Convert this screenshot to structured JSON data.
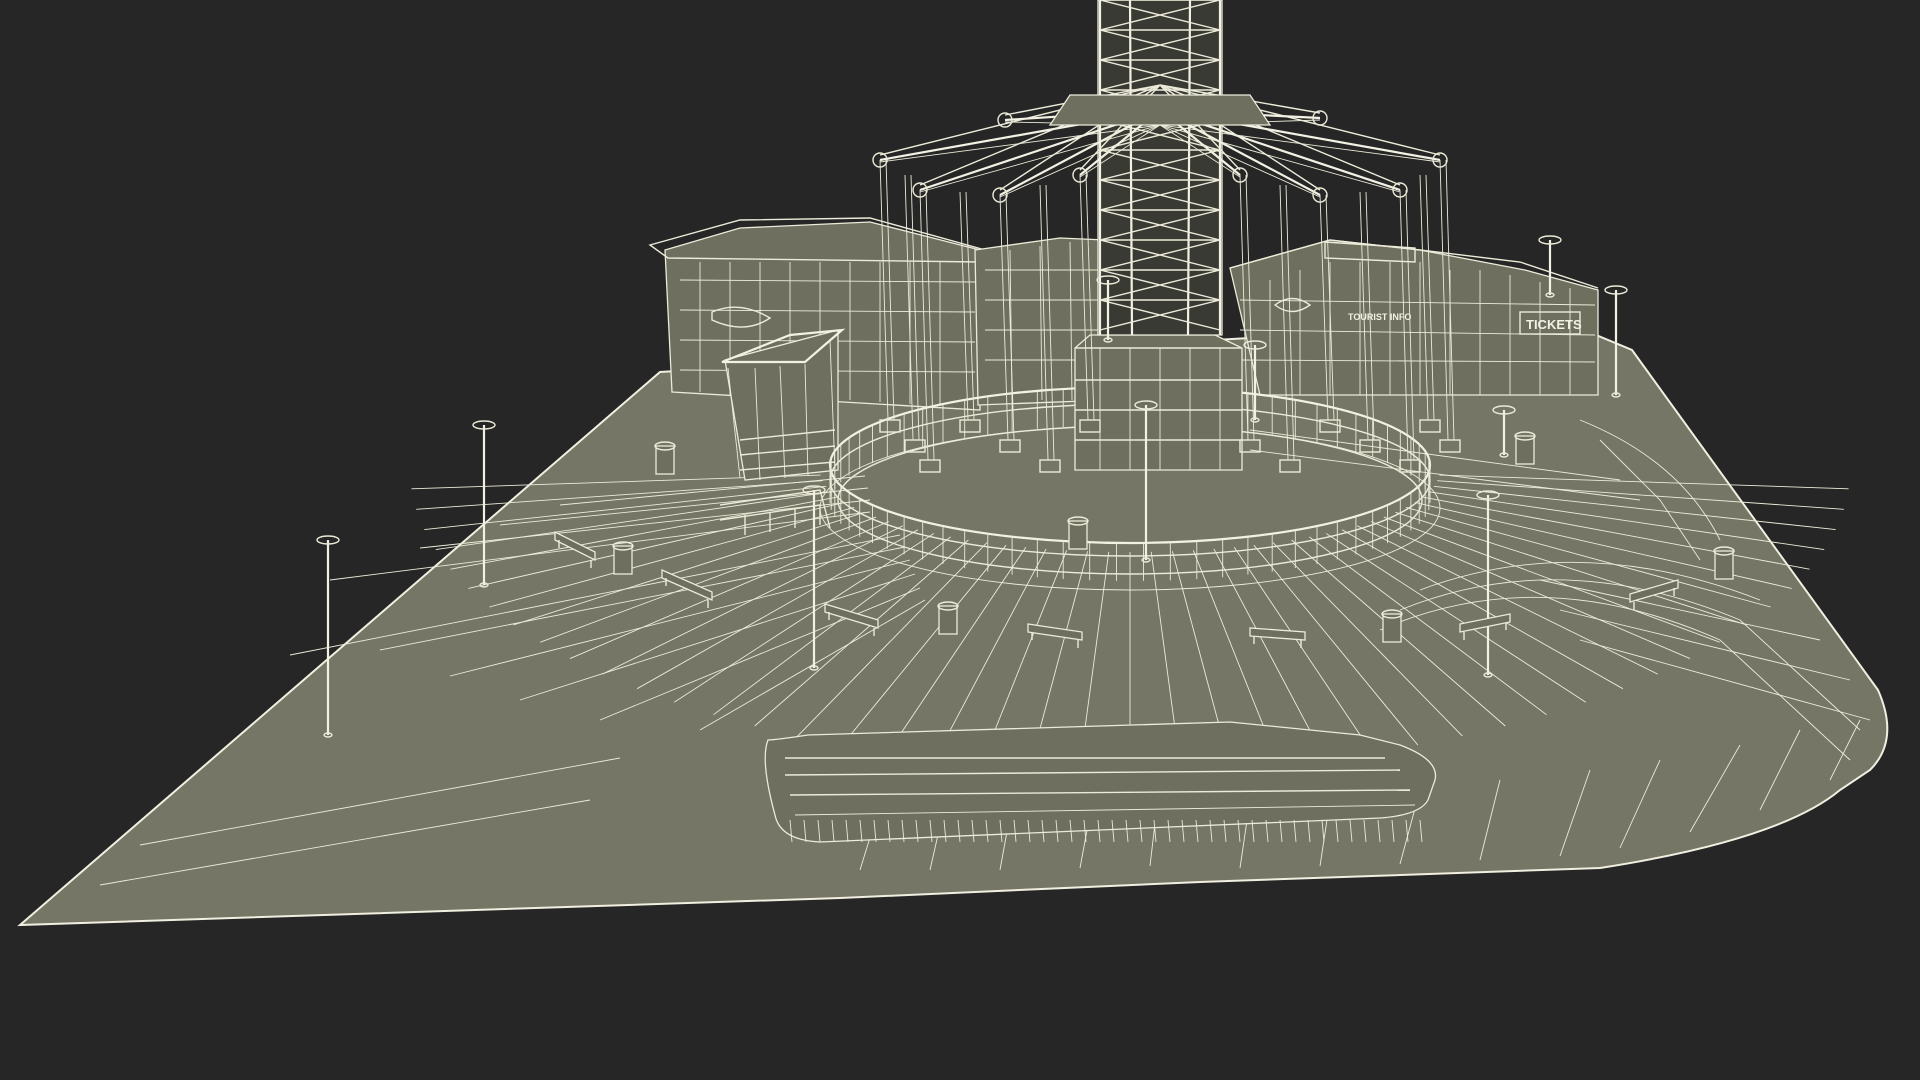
{
  "scene": {
    "background_color": "#262626",
    "ground_color": "#767666",
    "wire_color": "#ecebd9"
  },
  "signs": {
    "tickets": "TICKETS",
    "tourist_info": "TOURIST INFO"
  }
}
